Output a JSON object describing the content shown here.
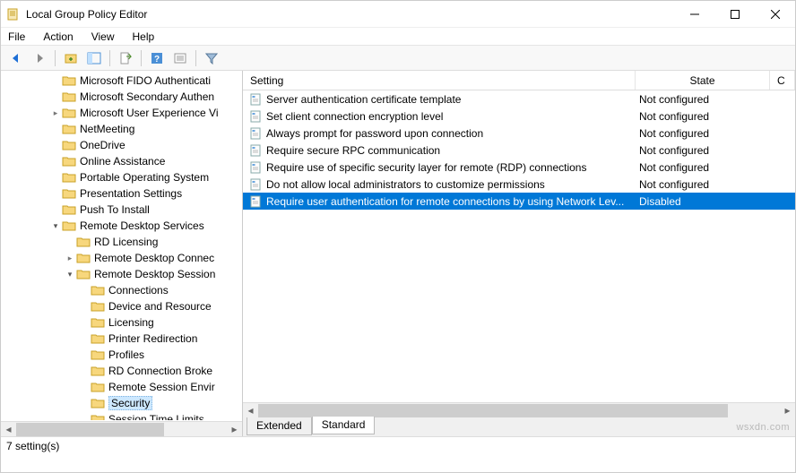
{
  "window": {
    "title": "Local Group Policy Editor"
  },
  "menubar": [
    "File",
    "Action",
    "View",
    "Help"
  ],
  "tree": [
    {
      "indent": 3,
      "caret": "",
      "label": "Microsoft FIDO Authenticati"
    },
    {
      "indent": 3,
      "caret": "",
      "label": "Microsoft Secondary Authen"
    },
    {
      "indent": 3,
      "caret": ">",
      "label": "Microsoft User Experience Vi"
    },
    {
      "indent": 3,
      "caret": "",
      "label": "NetMeeting"
    },
    {
      "indent": 3,
      "caret": "",
      "label": "OneDrive"
    },
    {
      "indent": 3,
      "caret": "",
      "label": "Online Assistance"
    },
    {
      "indent": 3,
      "caret": "",
      "label": "Portable Operating System"
    },
    {
      "indent": 3,
      "caret": "",
      "label": "Presentation Settings"
    },
    {
      "indent": 3,
      "caret": "",
      "label": "Push To Install"
    },
    {
      "indent": 3,
      "caret": "v",
      "label": "Remote Desktop Services"
    },
    {
      "indent": 4,
      "caret": "",
      "label": "RD Licensing"
    },
    {
      "indent": 4,
      "caret": ">",
      "label": "Remote Desktop Connec"
    },
    {
      "indent": 4,
      "caret": "v",
      "label": "Remote Desktop Session"
    },
    {
      "indent": 5,
      "caret": "",
      "label": "Connections"
    },
    {
      "indent": 5,
      "caret": "",
      "label": "Device and Resource"
    },
    {
      "indent": 5,
      "caret": "",
      "label": "Licensing"
    },
    {
      "indent": 5,
      "caret": "",
      "label": "Printer Redirection"
    },
    {
      "indent": 5,
      "caret": "",
      "label": "Profiles"
    },
    {
      "indent": 5,
      "caret": "",
      "label": "RD Connection Broke"
    },
    {
      "indent": 5,
      "caret": "",
      "label": "Remote Session Envir"
    },
    {
      "indent": 5,
      "caret": "",
      "label": "Security",
      "selected": true
    },
    {
      "indent": 5,
      "caret": "",
      "label": "Session Time Limits"
    }
  ],
  "columns": {
    "setting": "Setting",
    "state": "State"
  },
  "settings": [
    {
      "name": "Server authentication certificate template",
      "state": "Not configured"
    },
    {
      "name": "Set client connection encryption level",
      "state": "Not configured"
    },
    {
      "name": "Always prompt for password upon connection",
      "state": "Not configured"
    },
    {
      "name": "Require secure RPC communication",
      "state": "Not configured"
    },
    {
      "name": "Require use of specific security layer for remote (RDP) connections",
      "state": "Not configured"
    },
    {
      "name": "Do not allow local administrators to customize permissions",
      "state": "Not configured"
    },
    {
      "name": "Require user authentication for remote connections by using Network Lev...",
      "state": "Disabled",
      "selected": true
    }
  ],
  "tabs": [
    "Extended",
    "Standard"
  ],
  "statusbar": "7 setting(s)",
  "watermark": "wsxdn.com"
}
